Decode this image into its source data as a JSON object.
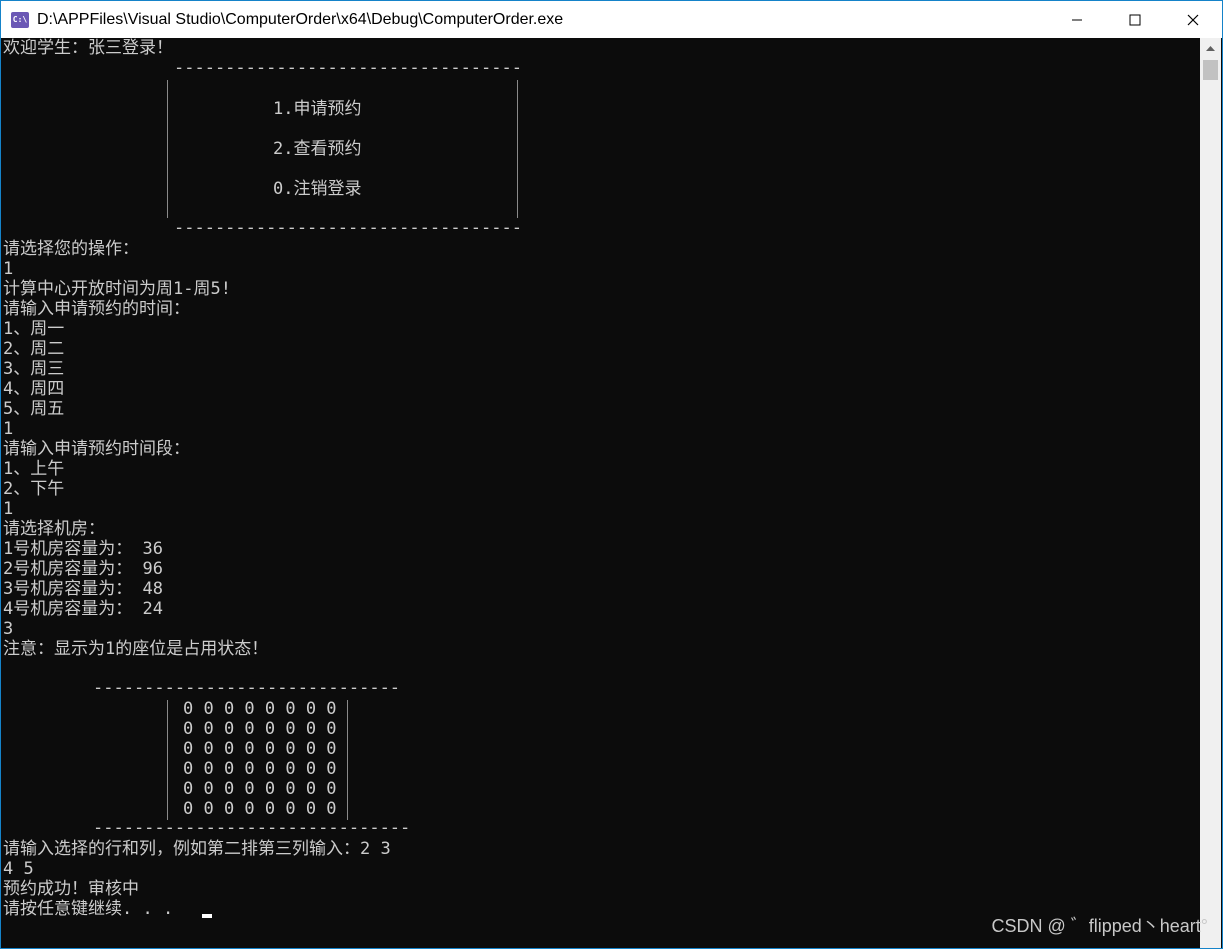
{
  "window": {
    "title": "D:\\APPFiles\\Visual Studio\\ComputerOrder\\x64\\Debug\\ComputerOrder.exe",
    "icon_label": "C:\\",
    "accent": "#1583c9"
  },
  "console": {
    "welcome": "欢迎学生：张三登录！",
    "menu_top_rule": "----------------------------------",
    "menu_items": [
      "1.申请预约",
      "2.查看预约",
      "0.注销登录"
    ],
    "menu_bottom_rule": "----------------------------------",
    "prompt_op": "请选择您的操作：",
    "input_op": "1",
    "open_time": "计算中心开放时间为周1-周5!",
    "prompt_day": "请输入申请预约的时间：",
    "days": [
      "1、周一",
      "2、周二",
      "3、周三",
      "4、周四",
      "5、周五"
    ],
    "input_day": "1",
    "prompt_period": "请输入申请预约时间段：",
    "periods": [
      "1、上午",
      "2、下午"
    ],
    "input_period": "1",
    "prompt_room": "请选择机房：",
    "rooms": [
      "1号机房容量为： 36",
      "2号机房容量为： 96",
      "3号机房容量为： 48",
      "4号机房容量为： 24"
    ],
    "input_room": "3",
    "notice": "注意：显示为1的座位是占用状态！",
    "seat_top_rule": "------------------------------",
    "seat_rows": [
      "0 0 0 0 0 0 0 0",
      "0 0 0 0 0 0 0 0",
      "0 0 0 0 0 0 0 0",
      "0 0 0 0 0 0 0 0",
      "0 0 0 0 0 0 0 0",
      "0 0 0 0 0 0 0 0"
    ],
    "seat_bottom_rule": "-------------------------------",
    "prompt_seat": "请输入选择的行和列，例如第二排第三列输入：2 3",
    "input_seat": "4 5",
    "success": "预约成功！审核中",
    "continue": "请按任意键继续. . ."
  },
  "watermark": "CSDN @ ゛flipped丶heart°"
}
